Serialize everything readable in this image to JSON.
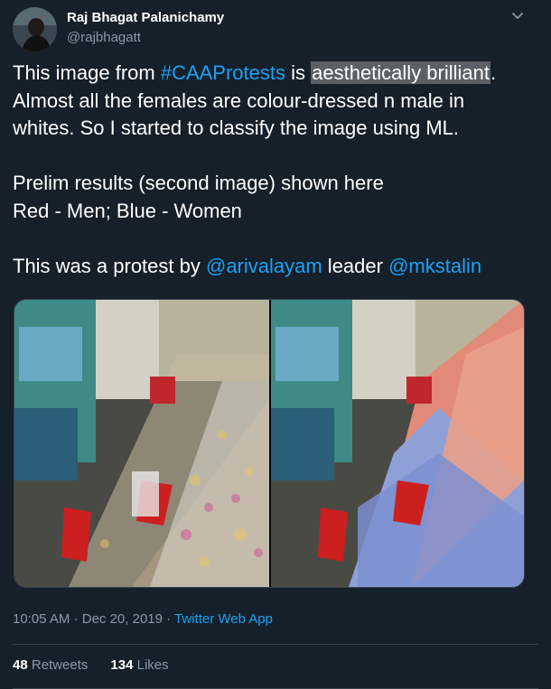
{
  "author": {
    "name": "Raj Bhagat Palanichamy",
    "handle": "@rajbhagatt"
  },
  "tweet": {
    "line1_pre": "This image from ",
    "line1_hashtag": "#CAAProtests",
    "line1_mid": " is ",
    "line1_highlight": "aesthetically brilliant",
    "line1_post": ".",
    "line2": "Almost all the females are colour-dressed n male in",
    "line3": "whites. So I started to classify the image using ML.",
    "line4": "Prelim results (second image) shown here",
    "line5": "Red - Men; Blue - Women",
    "line6_pre": "This was a protest by ",
    "line6_mention1": "@arivalayam",
    "line6_mid": " leader ",
    "line6_mention2": "@mkstalin"
  },
  "meta": {
    "time": "10:05 AM",
    "separator": " · ",
    "date": "Dec 20, 2019",
    "source": "Twitter Web App"
  },
  "stats": {
    "retweets_count": "48",
    "retweets_label": "Retweets",
    "likes_count": "134",
    "likes_label": "Likes"
  },
  "colors": {
    "background": "#15202b",
    "link": "#1da1f2",
    "secondary_text": "#8899a6",
    "divider": "#38444d"
  },
  "icons": {
    "menu": "chevron-down-icon"
  }
}
